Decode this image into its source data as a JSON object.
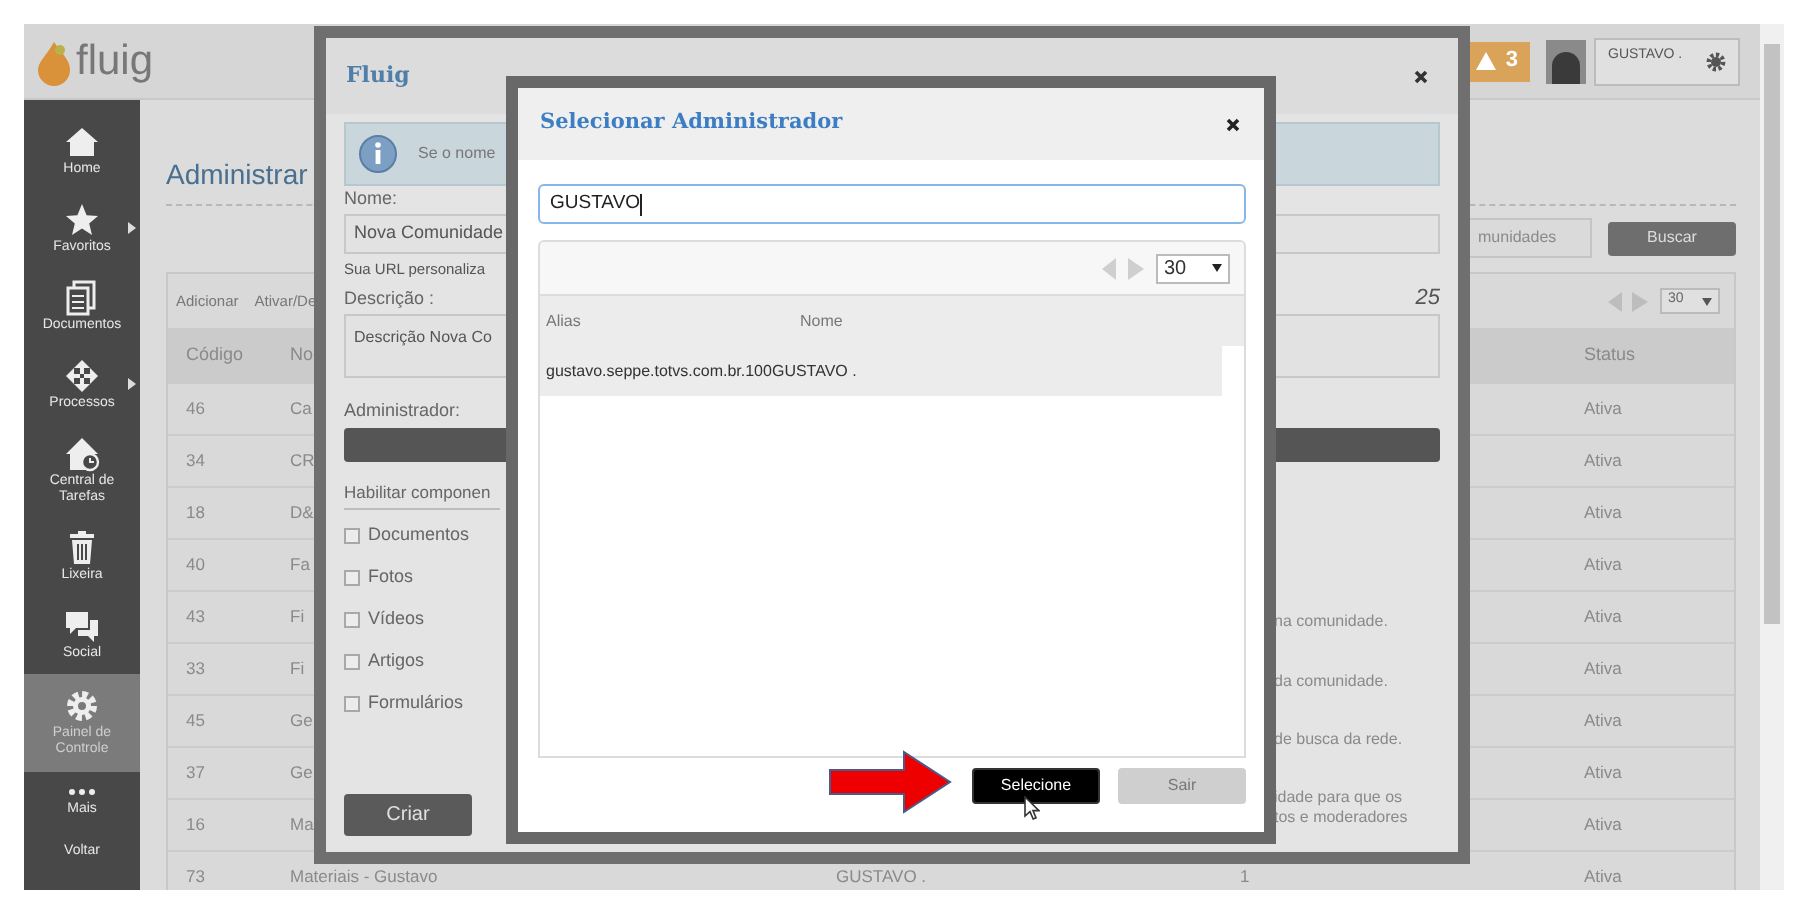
{
  "header": {
    "logo": "fluig",
    "alerts": "3",
    "user": "GUSTAVO ."
  },
  "sidebar": {
    "items": [
      {
        "label": "Home",
        "kind": "home",
        "submenu": false,
        "selected": false
      },
      {
        "label": "Favoritos",
        "kind": "star",
        "submenu": true,
        "selected": false
      },
      {
        "label": "Documentos",
        "kind": "documents",
        "submenu": false,
        "selected": false
      },
      {
        "label": "Processos",
        "kind": "process",
        "submenu": true,
        "selected": false
      },
      {
        "label": "Central de Tarefas",
        "kind": "tasks",
        "submenu": false,
        "selected": false
      },
      {
        "label": "Lixeira",
        "kind": "trash",
        "submenu": false,
        "selected": false
      },
      {
        "label": "Social",
        "kind": "chat",
        "submenu": false,
        "selected": false
      },
      {
        "label": "Painel de Controle",
        "kind": "gear",
        "submenu": false,
        "selected": true
      },
      {
        "label": "Mais",
        "kind": "dots",
        "submenu": false,
        "selected": false
      },
      {
        "label": "Voltar",
        "kind": "text",
        "submenu": false,
        "selected": false
      }
    ]
  },
  "page": {
    "title": "Administrar",
    "search_placeholder": "munidades",
    "search_button": "Buscar",
    "toolbar": [
      "Adicionar",
      "Ativar/De"
    ],
    "page_size": "30",
    "columns": [
      "Código",
      "No",
      "Status"
    ],
    "rows": [
      {
        "code": "46",
        "name": "Ca",
        "status": "Ativa"
      },
      {
        "code": "34",
        "name": "CR",
        "status": "Ativa"
      },
      {
        "code": "18",
        "name": "D&",
        "status": "Ativa"
      },
      {
        "code": "40",
        "name": "Fa",
        "status": "Ativa"
      },
      {
        "code": "43",
        "name": "Fi",
        "status": "Ativa"
      },
      {
        "code": "33",
        "name": "Fi",
        "status": "Ativa"
      },
      {
        "code": "45",
        "name": "Ge",
        "status": "Ativa"
      },
      {
        "code": "37",
        "name": "Ge",
        "status": "Ativa"
      },
      {
        "code": "16",
        "name": "Ma",
        "status": "Ativa"
      },
      {
        "code": "73",
        "name": "Materiais - Gustavo",
        "column_3": "GUSTAVO .",
        "column_4": "1",
        "status": "Ativa"
      }
    ]
  },
  "community_dialog": {
    "title": "Fluig",
    "info": "Se o nome",
    "name_label": "Nome:",
    "name_value": "Nova Comunidade",
    "url_label": "Sua URL personaliza",
    "description_label": "Descrição :",
    "description_count": "25",
    "description_value": "Descrição Nova Co",
    "admin_label": "Administrador:",
    "components_heading": "Habilitar componen",
    "components": [
      {
        "label": "Documentos",
        "checked": false
      },
      {
        "label": "Fotos",
        "checked": false
      },
      {
        "label": "Vídeos",
        "checked": false
      },
      {
        "label": "Artigos",
        "checked": false
      },
      {
        "label": "Formulários",
        "checked": false
      }
    ],
    "hints": [
      "na comunidade.",
      "da comunidade.",
      "de busca da rede.",
      "idade para que os",
      "tos e moderadores"
    ],
    "create_button": "Criar"
  },
  "admin_dialog": {
    "title": "Selecionar Administrador",
    "search_value": "GUSTAVO",
    "page_size": "30",
    "columns": [
      "Alias",
      "Nome"
    ],
    "rows": [
      {
        "alias": "gustavo.seppe.totvs.com.br.100",
        "name": "GUSTAVO .",
        "selected": true
      }
    ],
    "buttons": [
      {
        "label": "Selecione",
        "kind": "primary"
      },
      {
        "label": "Sair",
        "kind": "secondary"
      }
    ]
  }
}
